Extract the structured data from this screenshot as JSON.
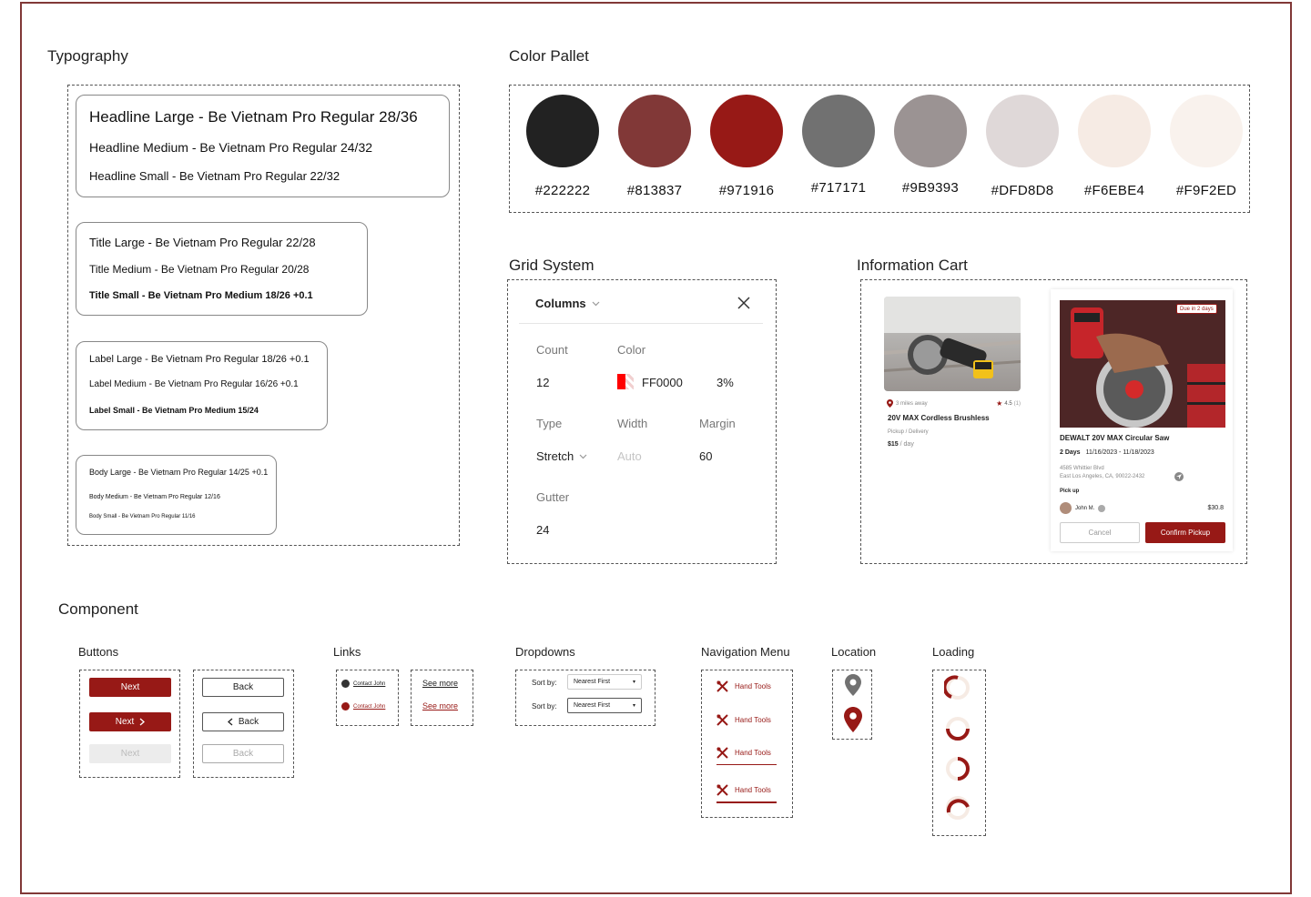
{
  "sections": {
    "typography": "Typography",
    "color_pallet": "Color Pallet",
    "grid_system": "Grid System",
    "information_cart": "Information Cart",
    "component": "Component"
  },
  "typography": {
    "headline_large": "Headline Large - Be Vietnam Pro Regular 28/36",
    "headline_medium": "Headline Medium - Be Vietnam Pro Regular 24/32",
    "headline_small": "Headline Small - Be Vietnam Pro Regular 22/32",
    "title_large": "Title Large - Be Vietnam Pro Regular 22/28",
    "title_medium": "Title Medium - Be Vietnam Pro Regular 20/28",
    "title_small": "Title Small - Be Vietnam Pro Medium 18/26 +0.1",
    "label_large": "Label Large - Be Vietnam Pro Regular 18/26 +0.1",
    "label_medium": "Label Medium - Be Vietnam Pro Regular 16/26 +0.1",
    "label_small": "Label Small -  Be Vietnam Pro Medium 15/24",
    "body_large": "Body Large - Be Vietnam Pro Regular 14/25 +0.1",
    "body_medium": "Body Medium - Be Vietnam Pro Regular 12/16",
    "body_small": "Body Small - Be Vietnam Pro Regular 11/16"
  },
  "palette": [
    {
      "hex": "#222222",
      "label": "#222222"
    },
    {
      "hex": "#813837",
      "label": "#813837"
    },
    {
      "hex": "#971916",
      "label": "#971916"
    },
    {
      "hex": "#717171",
      "label": "#717171"
    },
    {
      "hex": "#9B9393",
      "label": "#9B9393"
    },
    {
      "hex": "#DFD8D8",
      "label": "#DFD8D8"
    },
    {
      "hex": "#F6EBE4",
      "label": "#F6EBE4"
    },
    {
      "hex": "#F9F2ED",
      "label": "#F9F2ED"
    }
  ],
  "grid": {
    "header": "Columns",
    "count_label": "Count",
    "count_value": "12",
    "color_label": "Color",
    "color_value": "FF0000",
    "opacity_value": "3%",
    "type_label": "Type",
    "type_value": "Stretch",
    "width_label": "Width",
    "width_placeholder": "Auto",
    "margin_label": "Margin",
    "margin_value": "60",
    "gutter_label": "Gutter",
    "gutter_value": "24"
  },
  "cart1": {
    "distance": "3 miles away",
    "rating": "4.5",
    "rating_count": "(1)",
    "title": "20V MAX Cordless Brushless",
    "mode": "Pickup / Delivery",
    "price": "$15",
    "price_unit": "/ day"
  },
  "cart2": {
    "badge": "Due in 2 days",
    "title": "DEWALT 20V MAX Circular Saw",
    "days": "2 Days",
    "dates": "11/16/2023 - 11/18/2023",
    "address1": "4585 Whittier Blvd",
    "address2": "East Los Angeles, CA, 90022-2432",
    "pickup": "Pick up",
    "user": "John M.",
    "total": "$30.8",
    "cancel": "Cancel",
    "confirm": "Confirm Pickup"
  },
  "components": {
    "buttons": "Buttons",
    "links": "Links",
    "dropdowns": "Dropdowns",
    "navigation": "Navigation Menu",
    "location": "Location",
    "loading": "Loading"
  },
  "buttons": {
    "next": "Next",
    "back": "Back"
  },
  "links": {
    "contact": "Contact John",
    "see_more": "See more"
  },
  "dropdowns": {
    "sort_by": "Sort by:",
    "option": "Nearest First"
  },
  "nav": {
    "item": "Hand Tools"
  }
}
